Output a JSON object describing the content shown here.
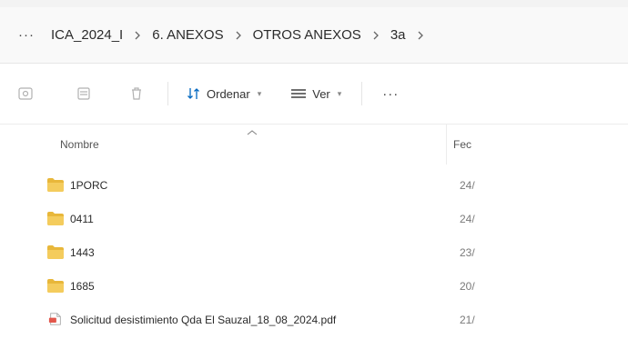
{
  "breadcrumb": {
    "more_label": "···",
    "segments": [
      "ICA_2024_I",
      "6. ANEXOS",
      "OTROS ANEXOS",
      "3a"
    ]
  },
  "toolbar": {
    "sort_label": "Ordenar",
    "view_label": "Ver",
    "more_label": "···"
  },
  "columns": {
    "name": "Nombre",
    "date": "Fec"
  },
  "files": [
    {
      "name": "1PORC",
      "date": "24/",
      "type": "folder"
    },
    {
      "name": "0411",
      "date": "24/",
      "type": "folder"
    },
    {
      "name": "1443",
      "date": "23/",
      "type": "folder"
    },
    {
      "name": "1685",
      "date": "20/",
      "type": "folder"
    },
    {
      "name": "Solicitud desistimiento Qda El Sauzal_18_08_2024.pdf",
      "date": "21/",
      "type": "pdf"
    }
  ],
  "colors": {
    "folder": "#f4cc5d",
    "pdf": "#e2574c",
    "accent": "#0067c0"
  }
}
